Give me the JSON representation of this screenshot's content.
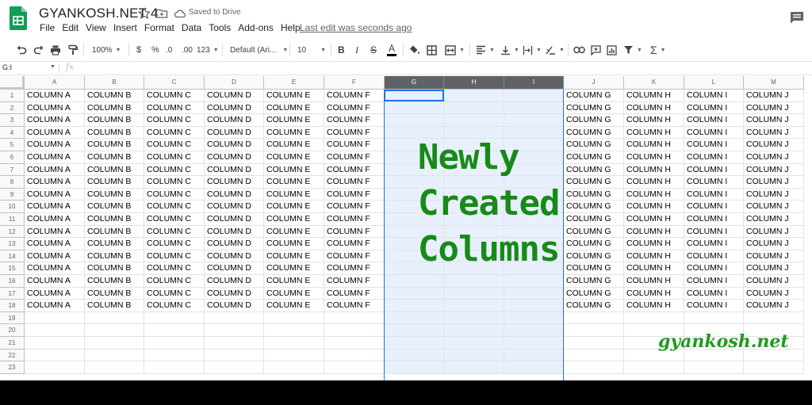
{
  "document": {
    "title": "GYANKOSH.NET 4",
    "saved_status": "Saved to Drive",
    "last_edit": "Last edit was seconds ago"
  },
  "menu": [
    "File",
    "Edit",
    "View",
    "Insert",
    "Format",
    "Data",
    "Tools",
    "Add-ons",
    "Help"
  ],
  "toolbar": {
    "zoom": "100%",
    "currency": "$",
    "percent": "%",
    "decimal_decrease": ".0",
    "decimal_increase": ".00",
    "more_formats": "123",
    "font_family": "Default (Ari...",
    "font_size": "10",
    "bold": "B",
    "italic": "I",
    "strike": "S",
    "text_color": "A",
    "sum": "Σ"
  },
  "formula_bar": {
    "name_box": "G:I",
    "fx_label": "fx",
    "value": ""
  },
  "grid": {
    "columns": [
      "A",
      "B",
      "C",
      "D",
      "E",
      "F",
      "G",
      "H",
      "I",
      "J",
      "K",
      "L",
      "M"
    ],
    "selected_columns": [
      "G",
      "H",
      "I"
    ],
    "row_numbers": [
      "1",
      "2",
      "3",
      "4",
      "5",
      "6",
      "7",
      "8",
      "9",
      "10",
      "11",
      "12",
      "13",
      "14",
      "15",
      "16",
      "17",
      "18",
      "19",
      "20",
      "21",
      "22",
      "23"
    ],
    "filled_rows": 18,
    "column_values": {
      "A": "COLUMN A",
      "B": "COLUMN B",
      "C": "COLUMN C",
      "D": "COLUMN D",
      "E": "COLUMN E",
      "F": "COLUMN F",
      "G": "",
      "H": "",
      "I": "",
      "J": "COLUMN G",
      "K": "COLUMN H",
      "L": "COLUMN I",
      "M": "COLUMN J"
    }
  },
  "overlay_text": [
    "Newly",
    "Created",
    "Columns"
  ],
  "watermark": "gyankosh.net",
  "colors": {
    "sheets_green": "#0f9d58",
    "selection_blue": "#1a73e8",
    "selection_fill": "#e8f0fe",
    "overlay_green": "#178a17",
    "selected_header": "#5f6368"
  },
  "icons": [
    "undo-icon",
    "redo-icon",
    "print-icon",
    "paint-format-icon",
    "text-color-icon",
    "fill-color-icon",
    "borders-icon",
    "merge-icon",
    "align-icon",
    "valign-icon",
    "wrap-icon",
    "rotate-icon",
    "link-icon",
    "comment-icon",
    "chart-icon",
    "filter-icon",
    "functions-icon",
    "star-icon",
    "folder-icon",
    "cloud-icon"
  ]
}
